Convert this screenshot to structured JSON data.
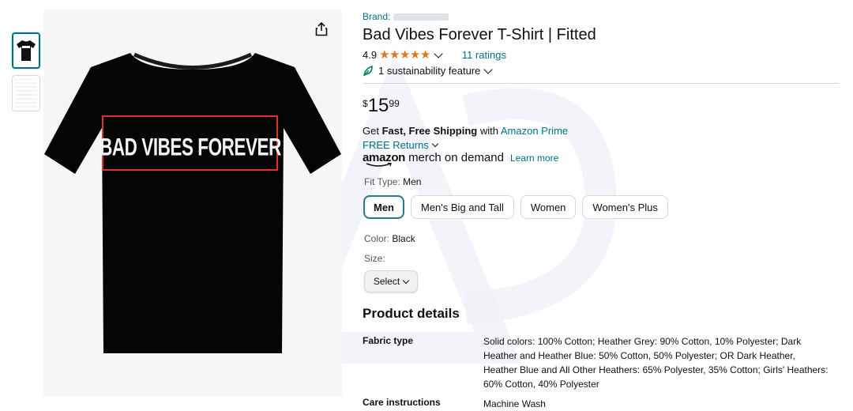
{
  "product": {
    "brand_prefix": "Brand:",
    "title": "Bad Vibes Forever T-Shirt | Fitted",
    "image_text": "BAD VIBES FOREVER",
    "rating_value": "4.9",
    "stars": "★★★★★",
    "ratings_count_text": "11 ratings",
    "sustainability_text": "1 sustainability feature"
  },
  "price": {
    "currency": "$",
    "whole": "15",
    "fraction": "99"
  },
  "shipping": {
    "get": "Get",
    "fast_free": "Fast, Free Shipping",
    "with": "with",
    "prime_link": "Amazon Prime",
    "returns": "FREE Returns",
    "mod_logo": "amazon",
    "mod_text": "merch on demand",
    "learn_more": "Learn more"
  },
  "fit": {
    "label": "Fit Type:",
    "selected": "Men",
    "options": [
      "Men",
      "Men's Big and Tall",
      "Women",
      "Women's Plus"
    ]
  },
  "color": {
    "label": "Color:",
    "value": "Black"
  },
  "size": {
    "label": "Size:",
    "select": "Select"
  },
  "details": {
    "heading": "Product details",
    "rows": [
      {
        "key": "Fabric type",
        "value": "Solid colors: 100% Cotton; Heather Grey: 90% Cotton, 10% Polyester; Dark Heather and Heather Blue: 50% Cotton, 50% Polyester; OR Dark Heather, Heather Blue and All Other Heathers: 65% Polyester, 35% Cotton; Girls' Heathers: 60% Cotton, 40% Polyester"
      },
      {
        "key": "Care instructions",
        "value": "Machine Wash"
      }
    ]
  },
  "icons": [
    "share-icon",
    "star-icon",
    "chevron-down-icon",
    "leaf-icon"
  ],
  "colors": {
    "link": "#007185",
    "star": "#de7921",
    "text": "#0f1111",
    "selected_border": "#2a7a91",
    "banner_border": "#e0342b"
  }
}
